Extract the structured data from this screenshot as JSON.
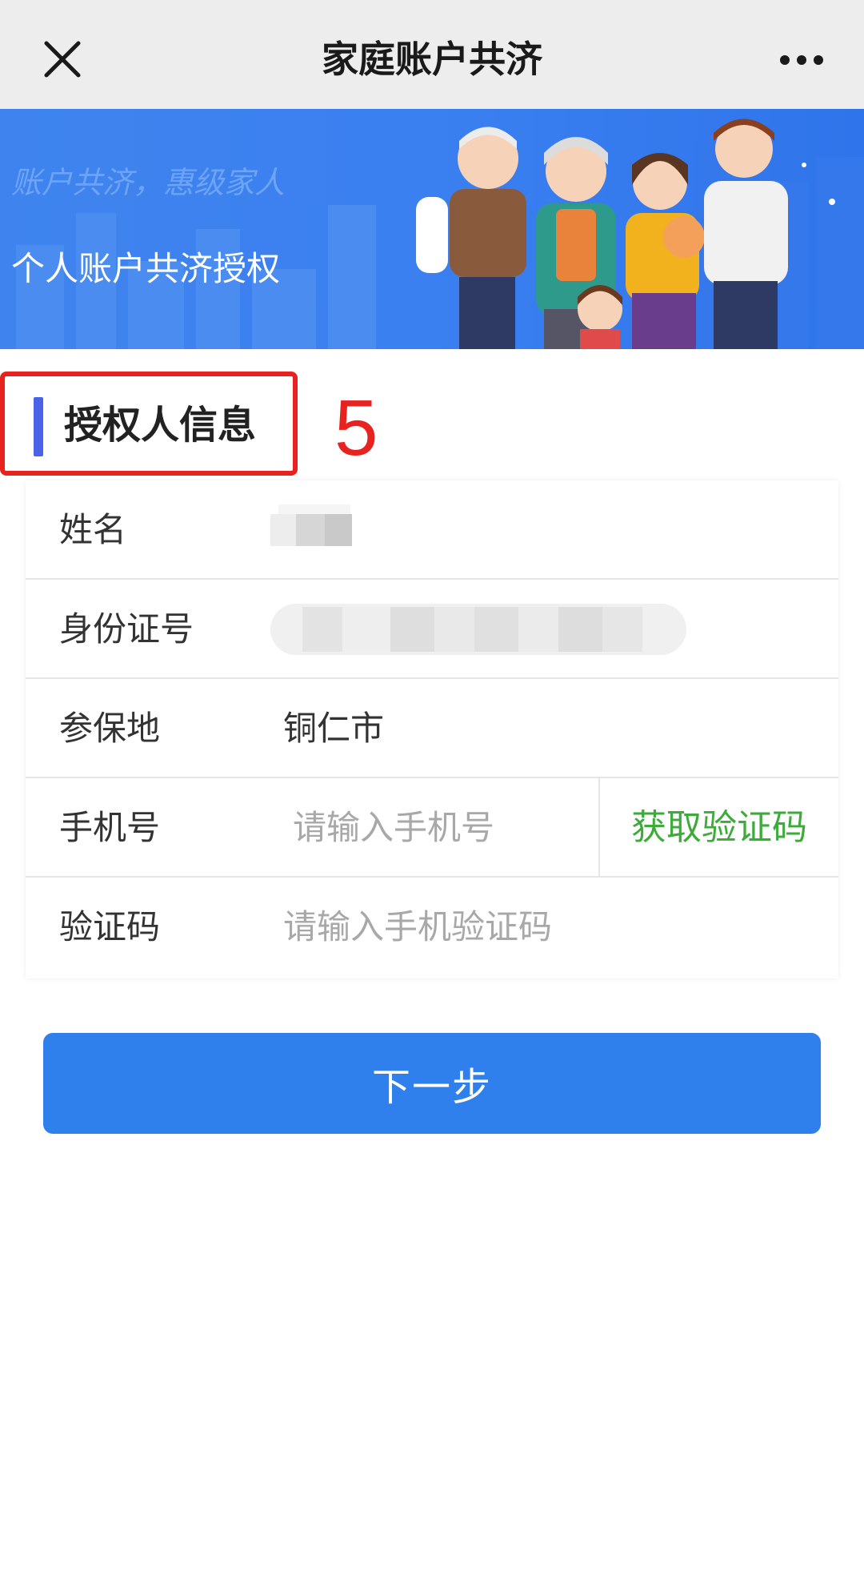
{
  "nav": {
    "title": "家庭账户共济",
    "close_icon": "close-icon",
    "more_icon": "more-horizontal-icon"
  },
  "banner": {
    "slogan": "账户共济，惠级家人",
    "subtitle": "个人账户共济授权"
  },
  "section": {
    "title": "授权人信息",
    "step_number": "5"
  },
  "form": {
    "name_label": "姓名",
    "id_label": "身份证号",
    "insured_place_label": "参保地",
    "insured_place_value": "铜仁市",
    "phone_label": "手机号",
    "phone_placeholder": "请输入手机号",
    "get_code_label": "获取验证码",
    "code_label": "验证码",
    "code_placeholder": "请输入手机验证码"
  },
  "next_button_label": "下一步",
  "colors": {
    "accent_blue": "#2f80ed",
    "section_bar": "#4a61e8",
    "get_code_green": "#3dab3a",
    "annotation_red": "#e8231f"
  }
}
